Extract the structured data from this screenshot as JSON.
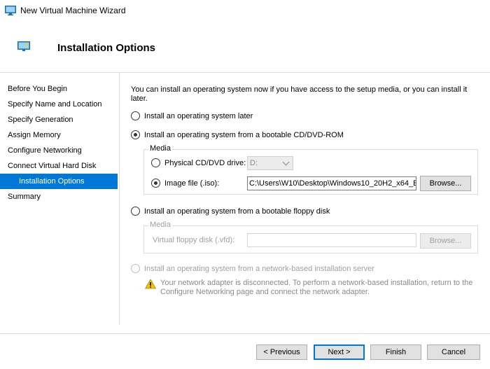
{
  "window": {
    "title": "New Virtual Machine Wizard"
  },
  "header": {
    "title": "Installation Options"
  },
  "sidebar": {
    "items": [
      {
        "label": "Before You Begin"
      },
      {
        "label": "Specify Name and Location"
      },
      {
        "label": "Specify Generation"
      },
      {
        "label": "Assign Memory"
      },
      {
        "label": "Configure Networking"
      },
      {
        "label": "Connect Virtual Hard Disk"
      },
      {
        "label": "Installation Options"
      },
      {
        "label": "Summary"
      }
    ]
  },
  "content": {
    "intro": "You can install an operating system now if you have access to the setup media, or you can install it later.",
    "option_later": "Install an operating system later",
    "option_cd": "Install an operating system from a bootable CD/DVD-ROM",
    "cd_media": {
      "group_label": "Media",
      "physical_label": "Physical CD/DVD drive:",
      "drive_value": "D:",
      "image_label": "Image file (.iso):",
      "image_path": "C:\\Users\\W10\\Desktop\\Windows10_20H2_x64_E",
      "browse_label": "Browse..."
    },
    "option_floppy": "Install an operating system from a bootable floppy disk",
    "floppy_media": {
      "group_label": "Media",
      "vfd_label": "Virtual floppy disk (.vfd):",
      "vfd_value": "",
      "browse_label": "Browse..."
    },
    "option_network": "Install an operating system from a network-based installation server",
    "network_warning": "Your network adapter is disconnected. To perform a network-based installation, return to the Configure Networking page and connect the network adapter."
  },
  "footer": {
    "previous_label": "< Previous",
    "next_label": "Next >",
    "finish_label": "Finish",
    "cancel_label": "Cancel"
  },
  "colors": {
    "accent": "#0078d7",
    "warning": "#f2c200"
  }
}
